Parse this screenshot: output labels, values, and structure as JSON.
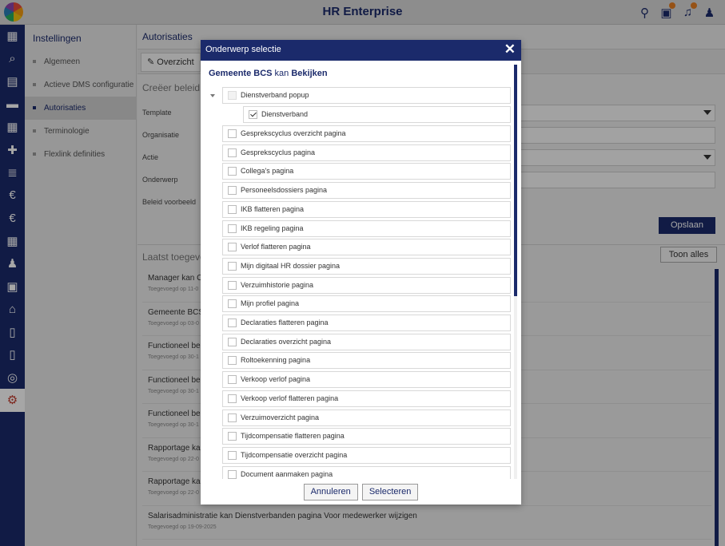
{
  "app": {
    "title": "HR Enterprise"
  },
  "topbar_icons": [
    "search-people-icon",
    "calendar-user-icon",
    "bell-icon",
    "user-icon"
  ],
  "rail": {
    "items": [
      {
        "icon": "dashboard-icon",
        "glyph": "▦"
      },
      {
        "icon": "search-icon",
        "glyph": "⌕"
      },
      {
        "icon": "id-card-icon",
        "glyph": "▤"
      },
      {
        "icon": "folder-icon",
        "glyph": "▬"
      },
      {
        "icon": "calendar-icon",
        "glyph": "▦"
      },
      {
        "icon": "medical-case-icon",
        "glyph": "✚"
      },
      {
        "icon": "document-search-icon",
        "glyph": "≣"
      },
      {
        "icon": "money-bag-icon",
        "glyph": "€"
      },
      {
        "icon": "euro-clock-icon",
        "glyph": "€"
      },
      {
        "icon": "calendar-clock-icon",
        "glyph": "▦"
      },
      {
        "icon": "user-check-icon",
        "glyph": "♟"
      },
      {
        "icon": "badge-icon",
        "glyph": "▣"
      },
      {
        "icon": "bank-icon",
        "glyph": "⌂"
      },
      {
        "icon": "document-icon",
        "glyph": "▯"
      },
      {
        "icon": "document-list-icon",
        "glyph": "▯"
      },
      {
        "icon": "hand-coin-icon",
        "glyph": "◎"
      },
      {
        "icon": "gear-icon",
        "glyph": "⚙",
        "active": true
      }
    ]
  },
  "settings_nav": {
    "title": "Instellingen",
    "items": [
      {
        "label": "Algemeen"
      },
      {
        "label": "Actieve DMS configuratie"
      },
      {
        "label": "Autorisaties",
        "active": true
      },
      {
        "label": "Terminologie"
      },
      {
        "label": "Flexlink definities"
      }
    ]
  },
  "main": {
    "breadcrumb": "Autorisaties",
    "tab_overview": "Overzicht",
    "create_title": "Creëer beleid",
    "form": {
      "template": "Template",
      "organisatie": "Organisatie",
      "actie": "Actie",
      "onderwerp": "Onderwerp",
      "beleid_voorbeeld": "Beleid voorbeeld"
    },
    "save": "Opslaan",
    "recent_title": "Laatst toegevoegd",
    "show_all": "Toon alles",
    "recent": [
      {
        "title": "Manager kan C",
        "date": "Toegevoegd op 11-0"
      },
      {
        "title": "Gemeente BCS",
        "date": "Toegevoegd op 03-0"
      },
      {
        "title": "Functioneel bel",
        "date": "Toegevoegd op 30-1"
      },
      {
        "title": "Functioneel bel",
        "date": "Toegevoegd op 30-1"
      },
      {
        "title": "Functioneel bel",
        "date": "Toegevoegd op 30-1"
      },
      {
        "title": "Rapportage kan",
        "date": "Toegevoegd op 22-0"
      },
      {
        "title": "Rapportage kan",
        "date": "Toegevoegd op 22-0"
      },
      {
        "title": "Salarisadministratie kan Dienstverbanden pagina Voor medewerker wijzigen",
        "date": "Toegevoegd op 19-09-2025"
      }
    ]
  },
  "modal": {
    "title": "Onderwerp selectie",
    "subject": "Gemeente BCS",
    "kan": "kan",
    "action": "Bekijken",
    "parent": {
      "label": "Dienstverband popup",
      "child": {
        "label": "Dienstverband",
        "checked": true
      }
    },
    "items": [
      "Gesprekscyclus overzicht pagina",
      "Gesprekscyclus pagina",
      "Collega's pagina",
      "Personeelsdossiers pagina",
      "IKB flatteren pagina",
      "IKB regeling pagina",
      "Verlof flatteren pagina",
      "Mijn digitaal HR dossier pagina",
      "Verzuimhistorie pagina",
      "Mijn profiel pagina",
      "Declaraties flatteren pagina",
      "Declaraties overzicht pagina",
      "Roltoekenning pagina",
      "Verkoop verlof pagina",
      "Verkoop verlof flatteren pagina",
      "Verzuimoverzicht pagina",
      "Tijdcompensatie flatteren pagina",
      "Tijdcompensatie overzicht pagina",
      "Document aanmaken pagina"
    ],
    "cancel": "Annuleren",
    "select": "Selecteren"
  }
}
